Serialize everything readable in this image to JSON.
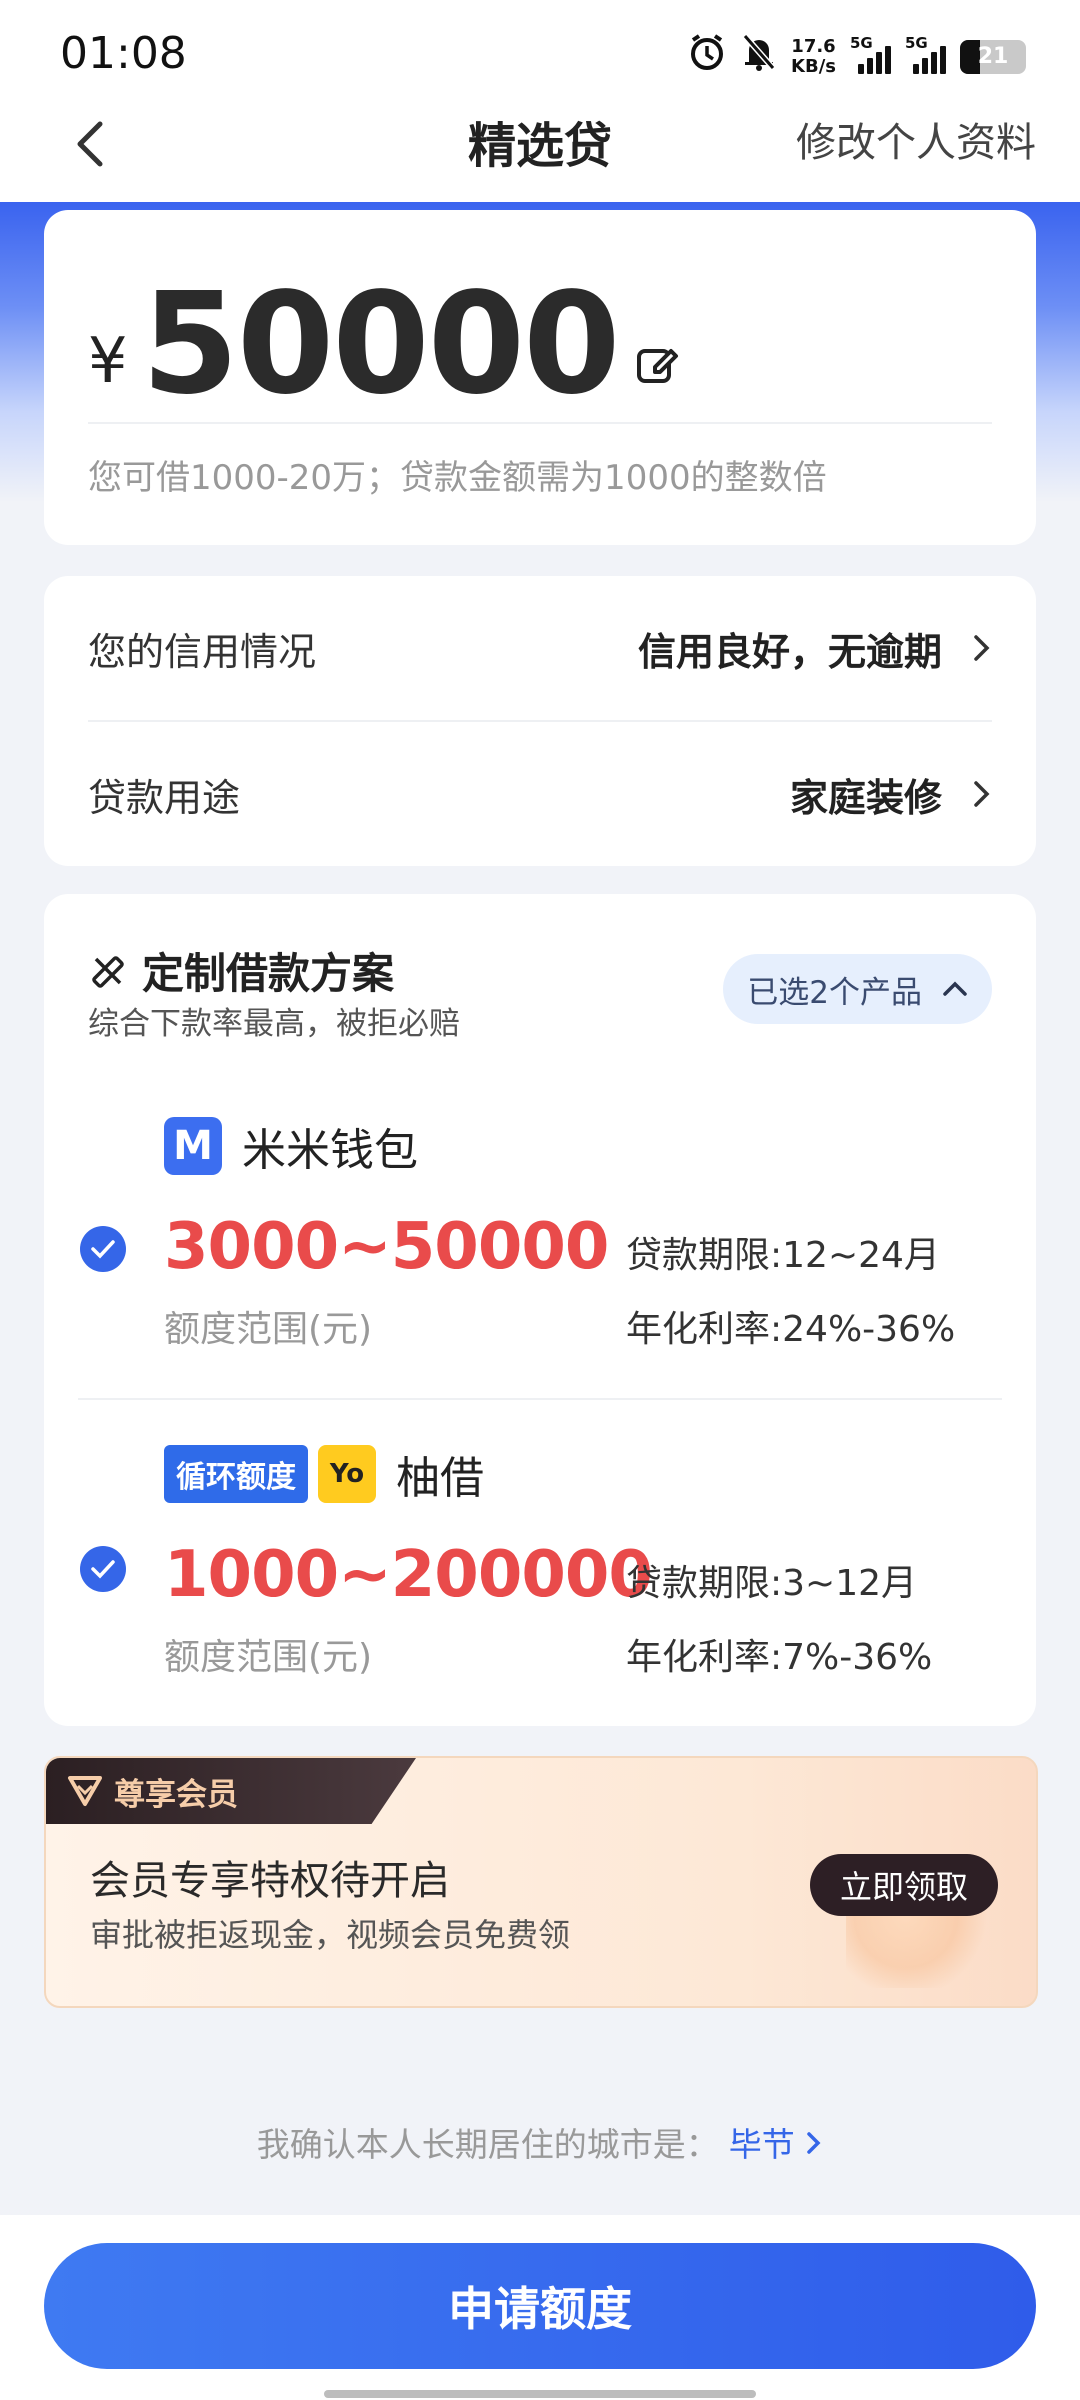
{
  "status_bar": {
    "time": "01:08",
    "net_speed_value": "17.6",
    "net_speed_unit": "KB/s",
    "signal1_label": "5G",
    "signal2_label": "5G",
    "battery": "21"
  },
  "nav": {
    "title": "精选贷",
    "right_action": "修改个人资料"
  },
  "amount": {
    "currency": "¥",
    "value": "50000",
    "hint": "您可借1000-20万；贷款金额需为1000的整数倍"
  },
  "info": {
    "credit_label": "您的信用情况",
    "credit_value": "信用良好，无逾期",
    "purpose_label": "贷款用途",
    "purpose_value": "家庭装修"
  },
  "plan": {
    "title": "定制借款方案",
    "subtitle": "综合下款率最高，被拒必赔",
    "selected_label": "已选2个产品",
    "products": [
      {
        "name": "米米钱包",
        "logo_letter": "M",
        "range": "3000~50000",
        "range_label": "额度范围(元)",
        "term": "贷款期限:12~24月",
        "rate": "年化利率:24%-36%"
      },
      {
        "name": "柚借",
        "tag": "循环额度",
        "logo_text": "Yo",
        "range": "1000~200000",
        "range_label": "额度范围(元)",
        "term": "贷款期限:3~12月",
        "rate": "年化利率:7%-36%"
      }
    ]
  },
  "vip": {
    "badge": "尊享会员",
    "title": "会员专享特权待开启",
    "subtitle": "审批被拒返现金，视频会员免费领",
    "button": "立即领取"
  },
  "city": {
    "prefix": "我确认本人长期居住的城市是：",
    "name": "毕节"
  },
  "apply_button": "申请额度",
  "colors": {
    "primary": "#3566e8",
    "amount_red": "#e94b4b",
    "vip_dark": "#2d1f25"
  }
}
